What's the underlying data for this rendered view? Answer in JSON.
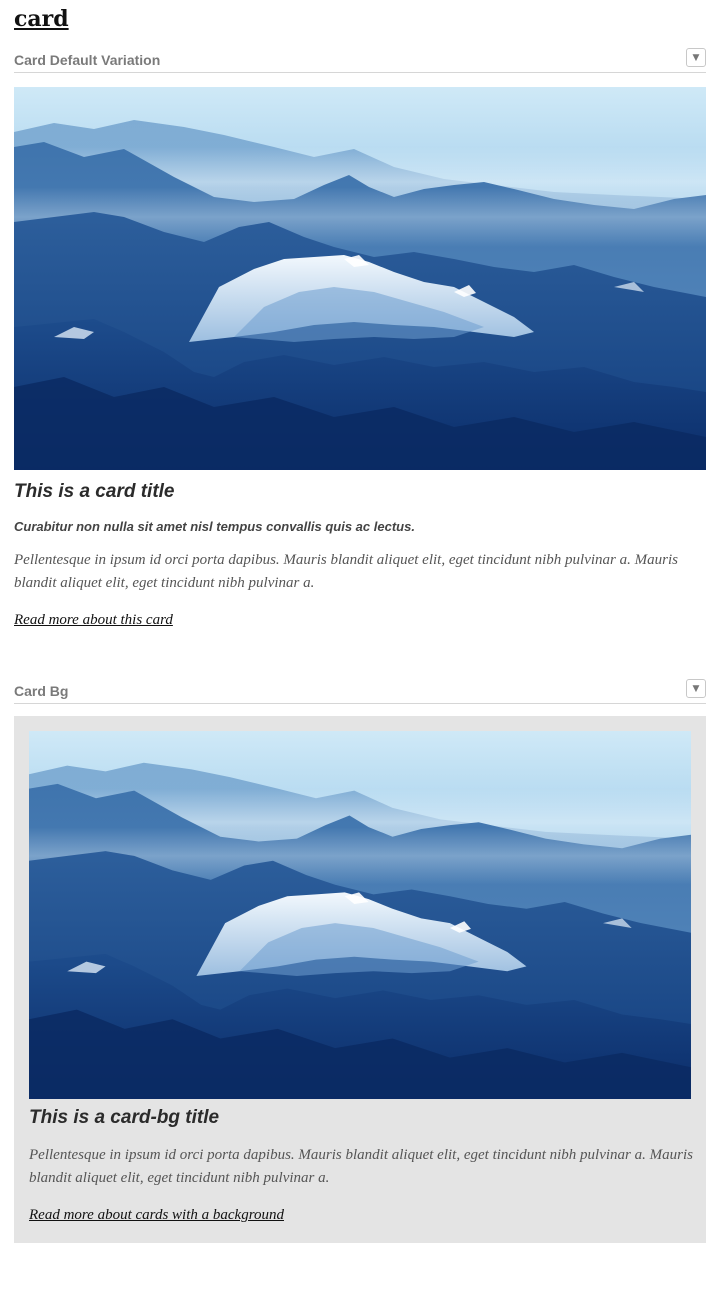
{
  "page": {
    "title": "card"
  },
  "sections": [
    {
      "label": "Card Default Variation",
      "toggle_icon": "▼",
      "card": {
        "image": "mountain-landscape",
        "title": "This is a card title",
        "subtitle": "Curabitur non nulla sit amet nisl tempus convallis quis ac lectus.",
        "body": "Pellentesque in ipsum id orci porta dapibus. Mauris blandit aliquet elit, eget tincidunt nibh pulvinar a. Mauris blandit aliquet elit, eget tincidunt nibh pulvinar a.",
        "link": "Read more about this card"
      }
    },
    {
      "label": "Card Bg",
      "toggle_icon": "▼",
      "card": {
        "image": "mountain-landscape",
        "title": "This is a card-bg title",
        "body": "Pellentesque in ipsum id orci porta dapibus. Mauris blandit aliquet elit, eget tincidunt nibh pulvinar a. Mauris blandit aliquet elit, eget tincidunt nibh pulvinar a.",
        "link": "Read more about cards with a background",
        "background_color": "#e4e4e4"
      }
    }
  ]
}
